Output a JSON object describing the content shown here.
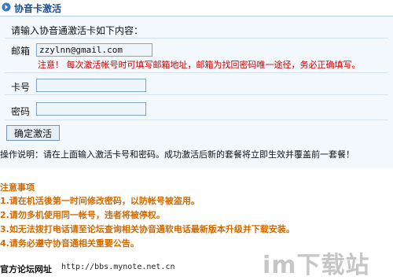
{
  "header": {
    "title": "协音卡激活"
  },
  "instruction": "请输入协音通激活卡如下内容：",
  "form": {
    "email_label": "邮箱",
    "email_value": "zzylnn@gmail.com",
    "note": "注意！ 每次激活帐号时可填写邮箱地址，邮箱为找回密码唯一途径，务必正确填写。",
    "card_label": "卡号",
    "card_value": "",
    "password_label": "密码",
    "password_value": "",
    "submit_label": "确定激活"
  },
  "operation_note": "操作说明：请在上面输入激活卡号和密码。成功激活后新的套餐将立即生效并覆盖前一套餐！",
  "notices": {
    "title": "注意事项",
    "items": [
      "1.请在机活後第一时间修改密码，以防帐号被盗用。",
      "2.请勿多机使用同一帐号，违者将被停权。",
      "3.如无法拨打电话请至论坛查询相关协音通软电话最新版本升级并下载安装。",
      "4.请务必遵守协音通相关重要公告。"
    ]
  },
  "footer": {
    "forum_label": "官方论坛网址",
    "forum_url": "http://bbs.mynote.net.cn"
  },
  "watermark": "im下载站"
}
